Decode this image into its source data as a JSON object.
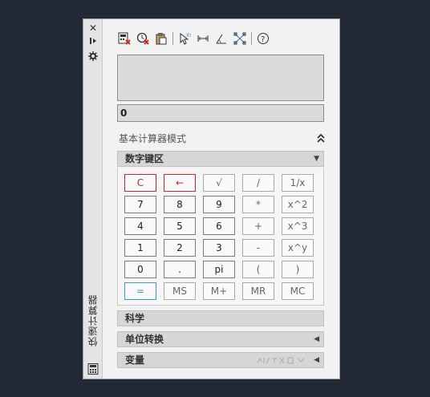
{
  "sidebar": {
    "title": "快速计算器"
  },
  "display": {
    "history": "",
    "input_value": "0"
  },
  "mode": {
    "label": "基本计算器模式"
  },
  "sections": {
    "numpad": "数字键区",
    "science": "科学",
    "units": "单位转换",
    "variables": "变量"
  },
  "keys": [
    [
      "C",
      "←",
      "√",
      "/",
      "1/x"
    ],
    [
      "7",
      "8",
      "9",
      "*",
      "x^2"
    ],
    [
      "4",
      "5",
      "6",
      "+",
      "x^3"
    ],
    [
      "1",
      "2",
      "3",
      "-",
      "x^y"
    ],
    [
      "0",
      ".",
      "pi",
      "(",
      ")"
    ],
    [
      "=",
      "MS",
      "M+",
      "MR",
      "MC"
    ]
  ],
  "colors": {
    "background": "#222a35",
    "accent_red": "#c8242c",
    "accent_blue": "#3a9ac8"
  }
}
